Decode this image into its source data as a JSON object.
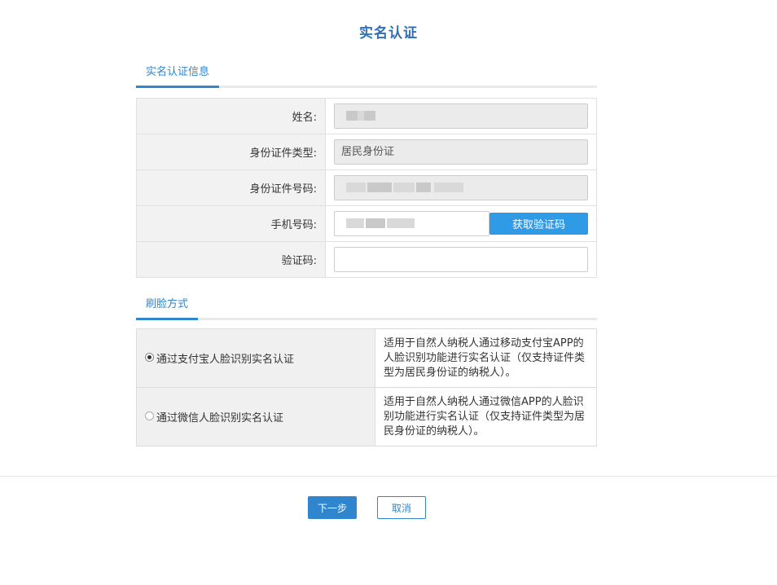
{
  "page": {
    "title": "实名认证"
  },
  "info_section": {
    "tab_label": "实名认证信息",
    "rows": [
      {
        "label": "姓名:",
        "value": ""
      },
      {
        "label": "身份证件类型:",
        "value": "居民身份证"
      },
      {
        "label": "身份证件号码:",
        "value": ""
      },
      {
        "label": "手机号码:",
        "value": ""
      },
      {
        "label": "验证码:",
        "value": ""
      }
    ],
    "get_code_label": "获取验证码"
  },
  "face_section": {
    "tab_label": "刷脸方式",
    "options": [
      {
        "label": "通过支付宝人脸识别实名认证",
        "selected": true,
        "description": "适用于自然人纳税人通过移动支付宝APP的人脸识别功能进行实名认证（仅支持证件类型为居民身份证的纳税人）。"
      },
      {
        "label": "通过微信人脸识别实名认证",
        "selected": false,
        "description": "适用于自然人纳税人通过微信APP的人脸识别功能进行实名认证（仅支持证件类型为居民身份证的纳税人）。"
      }
    ]
  },
  "footer": {
    "next_label": "下一步",
    "cancel_label": "取消"
  },
  "colors": {
    "accent": "#2f86cf",
    "button_blue": "#2f9ae6",
    "title": "#2f6fb6"
  }
}
